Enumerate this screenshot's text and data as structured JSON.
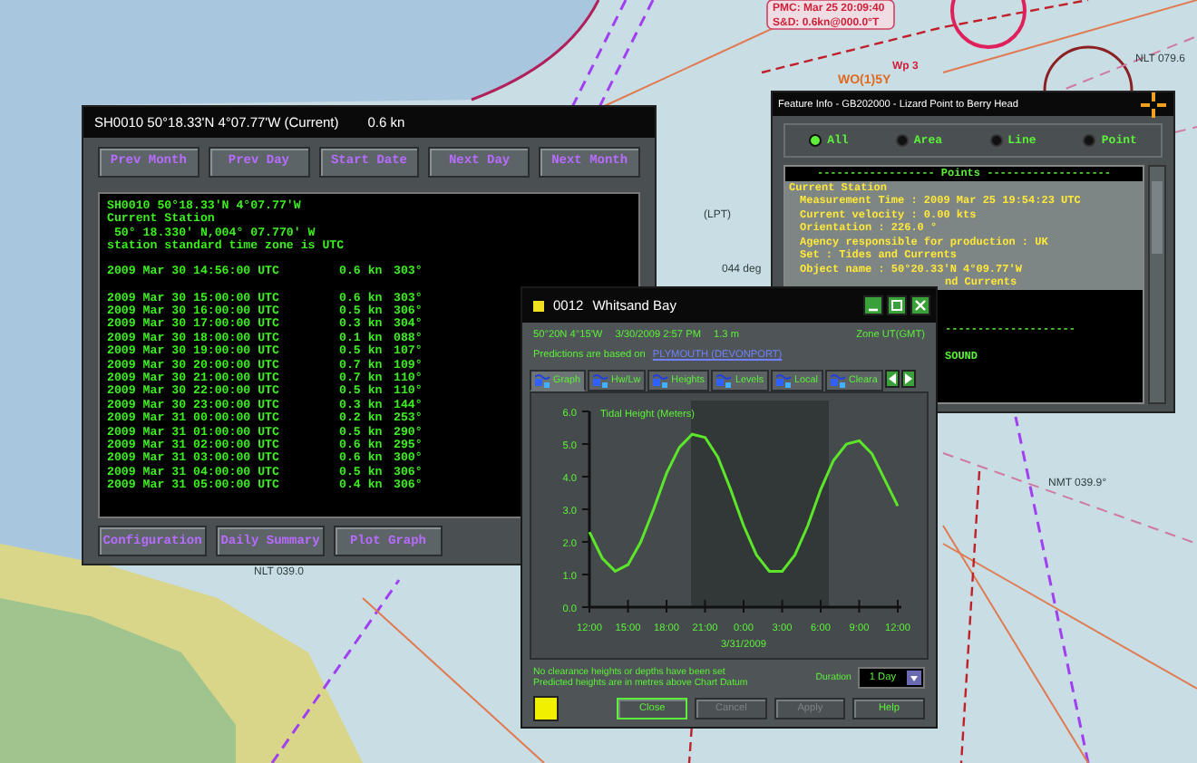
{
  "chart_labels": [
    {
      "text": "PMC: Mar 25 20:09:40",
      "kind": "box"
    },
    {
      "text": "S&D: 0.6kn@000.0°T",
      "kind": "box"
    },
    {
      "text": "Wp 3",
      "kind": "red"
    },
    {
      "text": "WO(1)5Y",
      "kind": "orange"
    },
    {
      "text": "NLT 079.6",
      "kind": "dark"
    },
    {
      "text": "(LPT)",
      "kind": "dark"
    },
    {
      "text": "044 deg",
      "kind": "dark"
    },
    {
      "text": "NLT 039.0",
      "kind": "dark"
    },
    {
      "text": "NMT 039.9°",
      "kind": "dark"
    }
  ],
  "station_window": {
    "title": "SH0010 50°18.33'N 4°07.77'W (Current)",
    "reading": "0.6 kn",
    "nav_buttons": [
      "Prev Month",
      "Prev Day",
      "Start Date",
      "Next Day",
      "Next Month"
    ],
    "header_lines": [
      "SH0010 50°18.33'N 4°07.77'W",
      "Current Station",
      " 50° 18.330' N,004° 07.770' W",
      "station standard time zone is UTC"
    ],
    "current_row": {
      "time": "2009 Mar 30 14:56:00 UTC",
      "speed": "0.6 kn",
      "direction": "303°"
    },
    "rows": [
      {
        "time": "2009 Mar 30 15:00:00 UTC",
        "speed": "0.6 kn",
        "direction": "303°"
      },
      {
        "time": "2009 Mar 30 16:00:00 UTC",
        "speed": "0.5 kn",
        "direction": "306°"
      },
      {
        "time": "2009 Mar 30 17:00:00 UTC",
        "speed": "0.3 kn",
        "direction": "304°"
      },
      {
        "time": "2009 Mar 30 18:00:00 UTC",
        "speed": "0.1 kn",
        "direction": "088°"
      },
      {
        "time": "2009 Mar 30 19:00:00 UTC",
        "speed": "0.5 kn",
        "direction": "107°"
      },
      {
        "time": "2009 Mar 30 20:00:00 UTC",
        "speed": "0.7 kn",
        "direction": "109°"
      },
      {
        "time": "2009 Mar 30 21:00:00 UTC",
        "speed": "0.7 kn",
        "direction": "110°"
      },
      {
        "time": "2009 Mar 30 22:00:00 UTC",
        "speed": "0.5 kn",
        "direction": "110°"
      },
      {
        "time": "2009 Mar 30 23:00:00 UTC",
        "speed": "0.3 kn",
        "direction": "144°"
      },
      {
        "time": "2009 Mar 31 00:00:00 UTC",
        "speed": "0.2 kn",
        "direction": "253°"
      },
      {
        "time": "2009 Mar 31 01:00:00 UTC",
        "speed": "0.5 kn",
        "direction": "290°"
      },
      {
        "time": "2009 Mar 31 02:00:00 UTC",
        "speed": "0.6 kn",
        "direction": "295°"
      },
      {
        "time": "2009 Mar 31 03:00:00 UTC",
        "speed": "0.6 kn",
        "direction": "300°"
      },
      {
        "time": "2009 Mar 31 04:00:00 UTC",
        "speed": "0.5 kn",
        "direction": "306°"
      },
      {
        "time": "2009 Mar 31 05:00:00 UTC",
        "speed": "0.4 kn",
        "direction": "306°"
      }
    ],
    "bottom_buttons": [
      "Configuration",
      "Daily Summary",
      "Plot Graph"
    ]
  },
  "feature_window": {
    "title": "Feature Info - GB202000 - Lizard Point to Berry Head",
    "filters": [
      {
        "label": "All",
        "selected": true
      },
      {
        "label": "Area",
        "selected": false
      },
      {
        "label": "Line",
        "selected": false
      },
      {
        "label": "Point",
        "selected": false
      }
    ],
    "upper_lines": [
      {
        "text": "------------------ Points -------------------",
        "kind": "heading"
      },
      {
        "text": "Current Station",
        "kind": "label"
      },
      {
        "text": "Measurement Time : 2009 Mar 25 19:54:23 UTC",
        "kind": "item"
      },
      {
        "text": "Current velocity : 0.00 kts",
        "kind": "item"
      },
      {
        "text": "Orientation : 226.0 °",
        "kind": "item"
      },
      {
        "text": "Agency responsible for production : UK",
        "kind": "item"
      },
      {
        "text": "Set : Tides and Currents",
        "kind": "item"
      },
      {
        "text": "Object name : 50°20.33'N 4°09.77'W",
        "kind": "item"
      },
      {
        "text": "nd Currents",
        "kind": "fragment"
      }
    ],
    "lower_lines": [
      {
        "text": "--------------------",
        "kind": "fragment"
      },
      {
        "text": "SOUND",
        "kind": "fragment"
      }
    ]
  },
  "tide_window": {
    "id": "0012",
    "title": "Whitsand Bay",
    "position": "50°20N 4°15'W",
    "time": "3/30/2009 2:57 PM",
    "height": "1.3 m",
    "zone": "Zone  UT(GMT)",
    "based_on": "Predictions are based on",
    "link": "PLYMOUTH (DEVONPORT)",
    "tabs": [
      {
        "label": "Graph",
        "selected": true
      },
      {
        "label": "Hw/Lw",
        "selected": false
      },
      {
        "label": "Heights",
        "selected": false
      },
      {
        "label": "Levels",
        "selected": false
      },
      {
        "label": "Local",
        "selected": false
      },
      {
        "label": "Cleara",
        "selected": false
      }
    ],
    "graph": {
      "date_label": "3/31/2009",
      "chart_data": {
        "type": "line",
        "title": "Tidal Height (Meters)",
        "categories": [
          "12:00",
          null,
          null,
          "15:00",
          null,
          null,
          "18:00",
          null,
          null,
          "21:00",
          null,
          null,
          "0:00",
          null,
          null,
          "3:00",
          null,
          null,
          "6:00",
          null,
          null,
          "9:00",
          null,
          null,
          "12:00"
        ],
        "series": [
          {
            "color": "#5ce62a",
            "values": [
              2.3,
              1.5,
              1.1,
              1.3,
              2.0,
              3.0,
              4.1,
              4.9,
              5.3,
              5.2,
              4.6,
              3.6,
              2.5,
              1.6,
              1.1,
              1.1,
              1.6,
              2.5,
              3.6,
              4.5,
              5.0,
              5.1,
              4.7,
              3.9,
              3.1
            ]
          }
        ],
        "ylim": [
          0,
          6
        ],
        "yticks": [
          {
            "value": 0,
            "label": "0.0"
          },
          {
            "value": 1,
            "label": "1.0"
          },
          {
            "value": 2,
            "label": "2.0"
          },
          {
            "value": 3,
            "label": "3.0"
          },
          {
            "value": 4,
            "label": "4.0"
          },
          {
            "value": 5,
            "label": "5.0"
          },
          {
            "value": 6,
            "label": "6.0"
          }
        ]
      }
    },
    "notes": [
      "No clearance heights or depths have been set",
      "Predicted heights are in metres above Chart Datum"
    ],
    "duration_label": "Duration",
    "duration": "1 Day",
    "buttons": [
      {
        "label": "Close",
        "disabled": false
      },
      {
        "label": "Cancel",
        "disabled": true
      },
      {
        "label": "Apply",
        "disabled": true
      },
      {
        "label": "Help",
        "disabled": false
      }
    ]
  }
}
